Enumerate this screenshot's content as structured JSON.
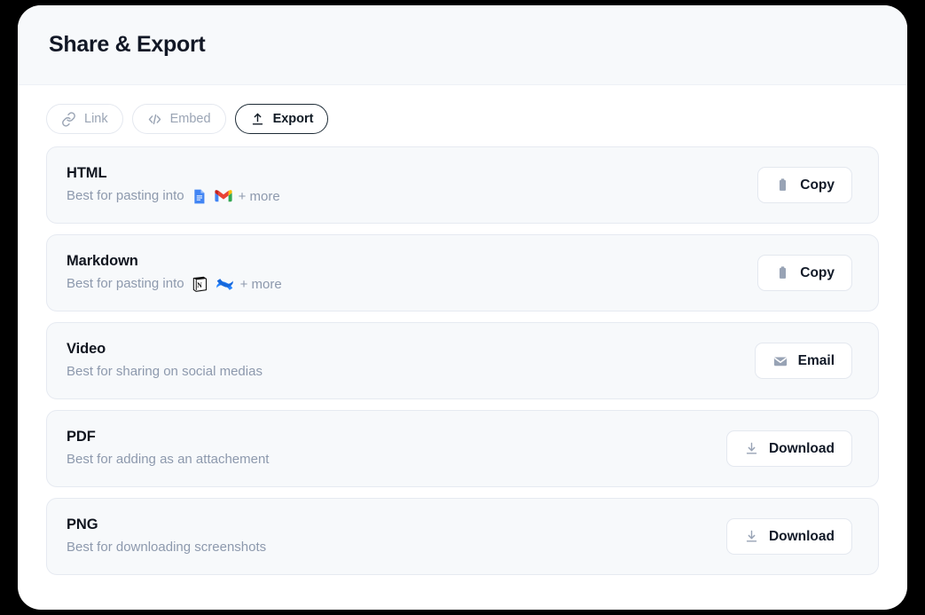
{
  "header": {
    "title": "Share & Export"
  },
  "tabs": [
    {
      "label": "Link",
      "icon": "link-icon",
      "active": false
    },
    {
      "label": "Embed",
      "icon": "code-icon",
      "active": false
    },
    {
      "label": "Export",
      "icon": "upload-icon",
      "active": true
    }
  ],
  "rows": [
    {
      "title": "HTML",
      "subtitle": "Best for pasting into",
      "apps": [
        "google-docs-icon",
        "gmail-icon"
      ],
      "more_label": "+ more",
      "action": {
        "label": "Copy",
        "icon": "clipboard-icon"
      }
    },
    {
      "title": "Markdown",
      "subtitle": "Best for pasting into",
      "apps": [
        "notion-icon",
        "confluence-icon"
      ],
      "more_label": "+ more",
      "action": {
        "label": "Copy",
        "icon": "clipboard-icon"
      }
    },
    {
      "title": "Video",
      "subtitle": "Best for sharing on social medias",
      "apps": [],
      "more_label": "",
      "action": {
        "label": "Email",
        "icon": "envelope-icon"
      }
    },
    {
      "title": "PDF",
      "subtitle": "Best for adding as an attachement",
      "apps": [],
      "more_label": "",
      "action": {
        "label": "Download",
        "icon": "download-icon"
      }
    },
    {
      "title": "PNG",
      "subtitle": "Best for downloading screenshots",
      "apps": [],
      "more_label": "",
      "action": {
        "label": "Download",
        "icon": "download-icon"
      }
    }
  ],
  "colors": {
    "panel_bg": "#ffffff",
    "header_bg": "#f7f9fb",
    "row_bg": "#f7f9fb",
    "row_border": "#e6eaf1",
    "title_text": "#10151f",
    "muted_text": "#8d99ad",
    "active_tab_border": "#1d2b36",
    "google_docs_blue": "#4285f4",
    "gmail_red": "#ea4335",
    "confluence_blue": "#2684ff"
  }
}
